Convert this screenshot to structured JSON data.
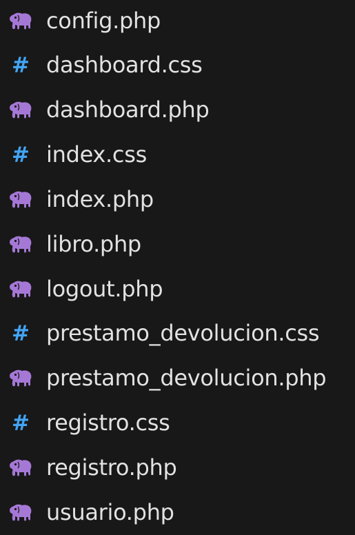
{
  "explorer": {
    "files": [
      {
        "name": "config.php",
        "icon": "php-elephant-icon",
        "kind": "php"
      },
      {
        "name": "dashboard.css",
        "icon": "css-hash-icon",
        "kind": "css"
      },
      {
        "name": "dashboard.php",
        "icon": "php-elephant-icon",
        "kind": "php"
      },
      {
        "name": "index.css",
        "icon": "css-hash-icon",
        "kind": "css"
      },
      {
        "name": "index.php",
        "icon": "php-elephant-icon",
        "kind": "php"
      },
      {
        "name": "libro.php",
        "icon": "php-elephant-icon",
        "kind": "php"
      },
      {
        "name": "logout.php",
        "icon": "php-elephant-icon",
        "kind": "php"
      },
      {
        "name": "prestamo_devolucion.css",
        "icon": "css-hash-icon",
        "kind": "css"
      },
      {
        "name": "prestamo_devolucion.php",
        "icon": "php-elephant-icon",
        "kind": "php"
      },
      {
        "name": "registro.css",
        "icon": "css-hash-icon",
        "kind": "css"
      },
      {
        "name": "registro.php",
        "icon": "php-elephant-icon",
        "kind": "php"
      },
      {
        "name": "usuario.php",
        "icon": "php-elephant-icon",
        "kind": "php"
      }
    ]
  },
  "colors": {
    "background": "#181818",
    "text": "#e2e2e2",
    "php_icon": "#a578d6",
    "css_icon": "#42a5f5"
  },
  "icons": {
    "css_glyph": "#"
  }
}
